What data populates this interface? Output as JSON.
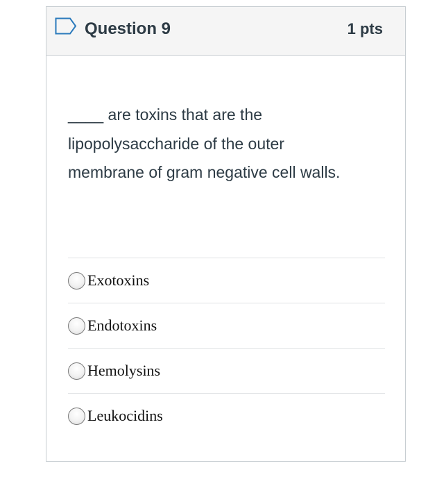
{
  "question": {
    "title": "Question 9",
    "points": "1 pts",
    "text": "____ are toxins that are the lipopolysaccharide of the outer membrane of gram negative cell walls."
  },
  "answers": [
    {
      "label": "Exotoxins"
    },
    {
      "label": "Endotoxins"
    },
    {
      "label": "Hemolysins"
    },
    {
      "label": "Leukocidins"
    }
  ],
  "icons": {
    "flag": "flag-icon",
    "radio": "radio-button"
  },
  "colors": {
    "header_bg": "#f5f5f5",
    "border": "#c7cdd1",
    "text": "#2d3b45",
    "flag": "#2b7abc"
  }
}
